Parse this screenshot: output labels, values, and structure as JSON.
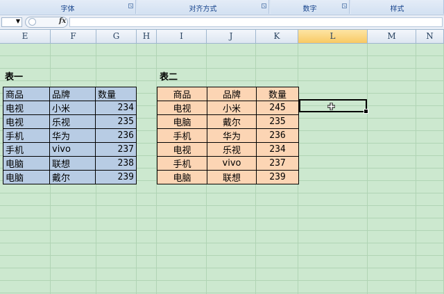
{
  "ribbon": {
    "groups": [
      {
        "label": "字体"
      },
      {
        "label": "对齐方式"
      },
      {
        "label": "数字"
      },
      {
        "label": "样式"
      }
    ]
  },
  "formula_bar": {
    "fx_label": "fx"
  },
  "columns": [
    "E",
    "F",
    "G",
    "H",
    "I",
    "J",
    "K",
    "L",
    "M",
    "N"
  ],
  "active_column": "L",
  "table1": {
    "title": "表一",
    "headers": [
      "商品",
      "品牌",
      "数量"
    ],
    "rows": [
      [
        "电视",
        "小米",
        "234"
      ],
      [
        "电视",
        "乐视",
        "235"
      ],
      [
        "手机",
        "华为",
        "236"
      ],
      [
        "手机",
        "vivo",
        "237"
      ],
      [
        "电脑",
        "联想",
        "238"
      ],
      [
        "电脑",
        "戴尔",
        "239"
      ]
    ]
  },
  "table2": {
    "title": "表二",
    "headers": [
      "商品",
      "品牌",
      "数量"
    ],
    "rows": [
      [
        "电视",
        "小米",
        "245"
      ],
      [
        "电脑",
        "戴尔",
        "235"
      ],
      [
        "手机",
        "华为",
        "236"
      ],
      [
        "电视",
        "乐视",
        "234"
      ],
      [
        "手机",
        "vivo",
        "237"
      ],
      [
        "电脑",
        "联想",
        "239"
      ]
    ]
  }
}
